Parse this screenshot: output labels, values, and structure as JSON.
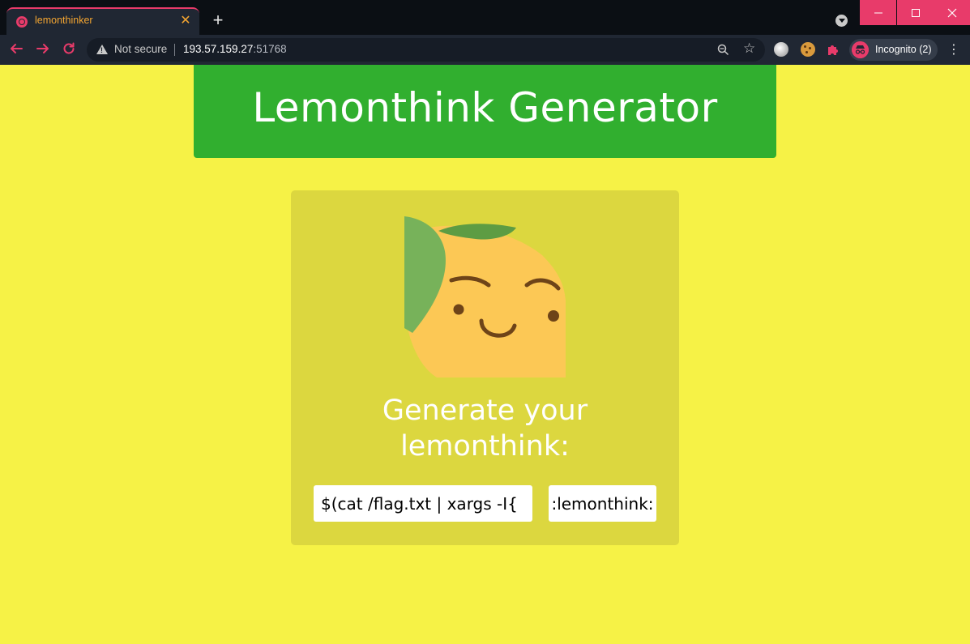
{
  "browser": {
    "tab": {
      "title": "lemonthinker",
      "close_glyph": "✕"
    },
    "new_tab_glyph": "+",
    "window_controls": {
      "minimize": "—",
      "maximize": "☐",
      "close": "✕"
    },
    "nav": {
      "back": "←",
      "forward": "→",
      "reload": "↻"
    },
    "address_bar": {
      "security_label": "Not secure",
      "url_host": "193.57.159.27",
      "url_port": ":51768"
    },
    "profile": {
      "label": "Incognito (2)"
    },
    "menu_glyph": "⋮",
    "star_glyph": "☆",
    "accent_color": "#e83b6a"
  },
  "page": {
    "header_title": "Lemonthink Generator",
    "card_heading_line1": "Generate your",
    "card_heading_line2": "lemonthink:",
    "input_value": "$(cat /flag.txt | xargs -I{",
    "submit_label": ":lemonthink:",
    "colors": {
      "background": "#f6f246",
      "header": "#31af2f",
      "card": "#dcd73f"
    }
  }
}
